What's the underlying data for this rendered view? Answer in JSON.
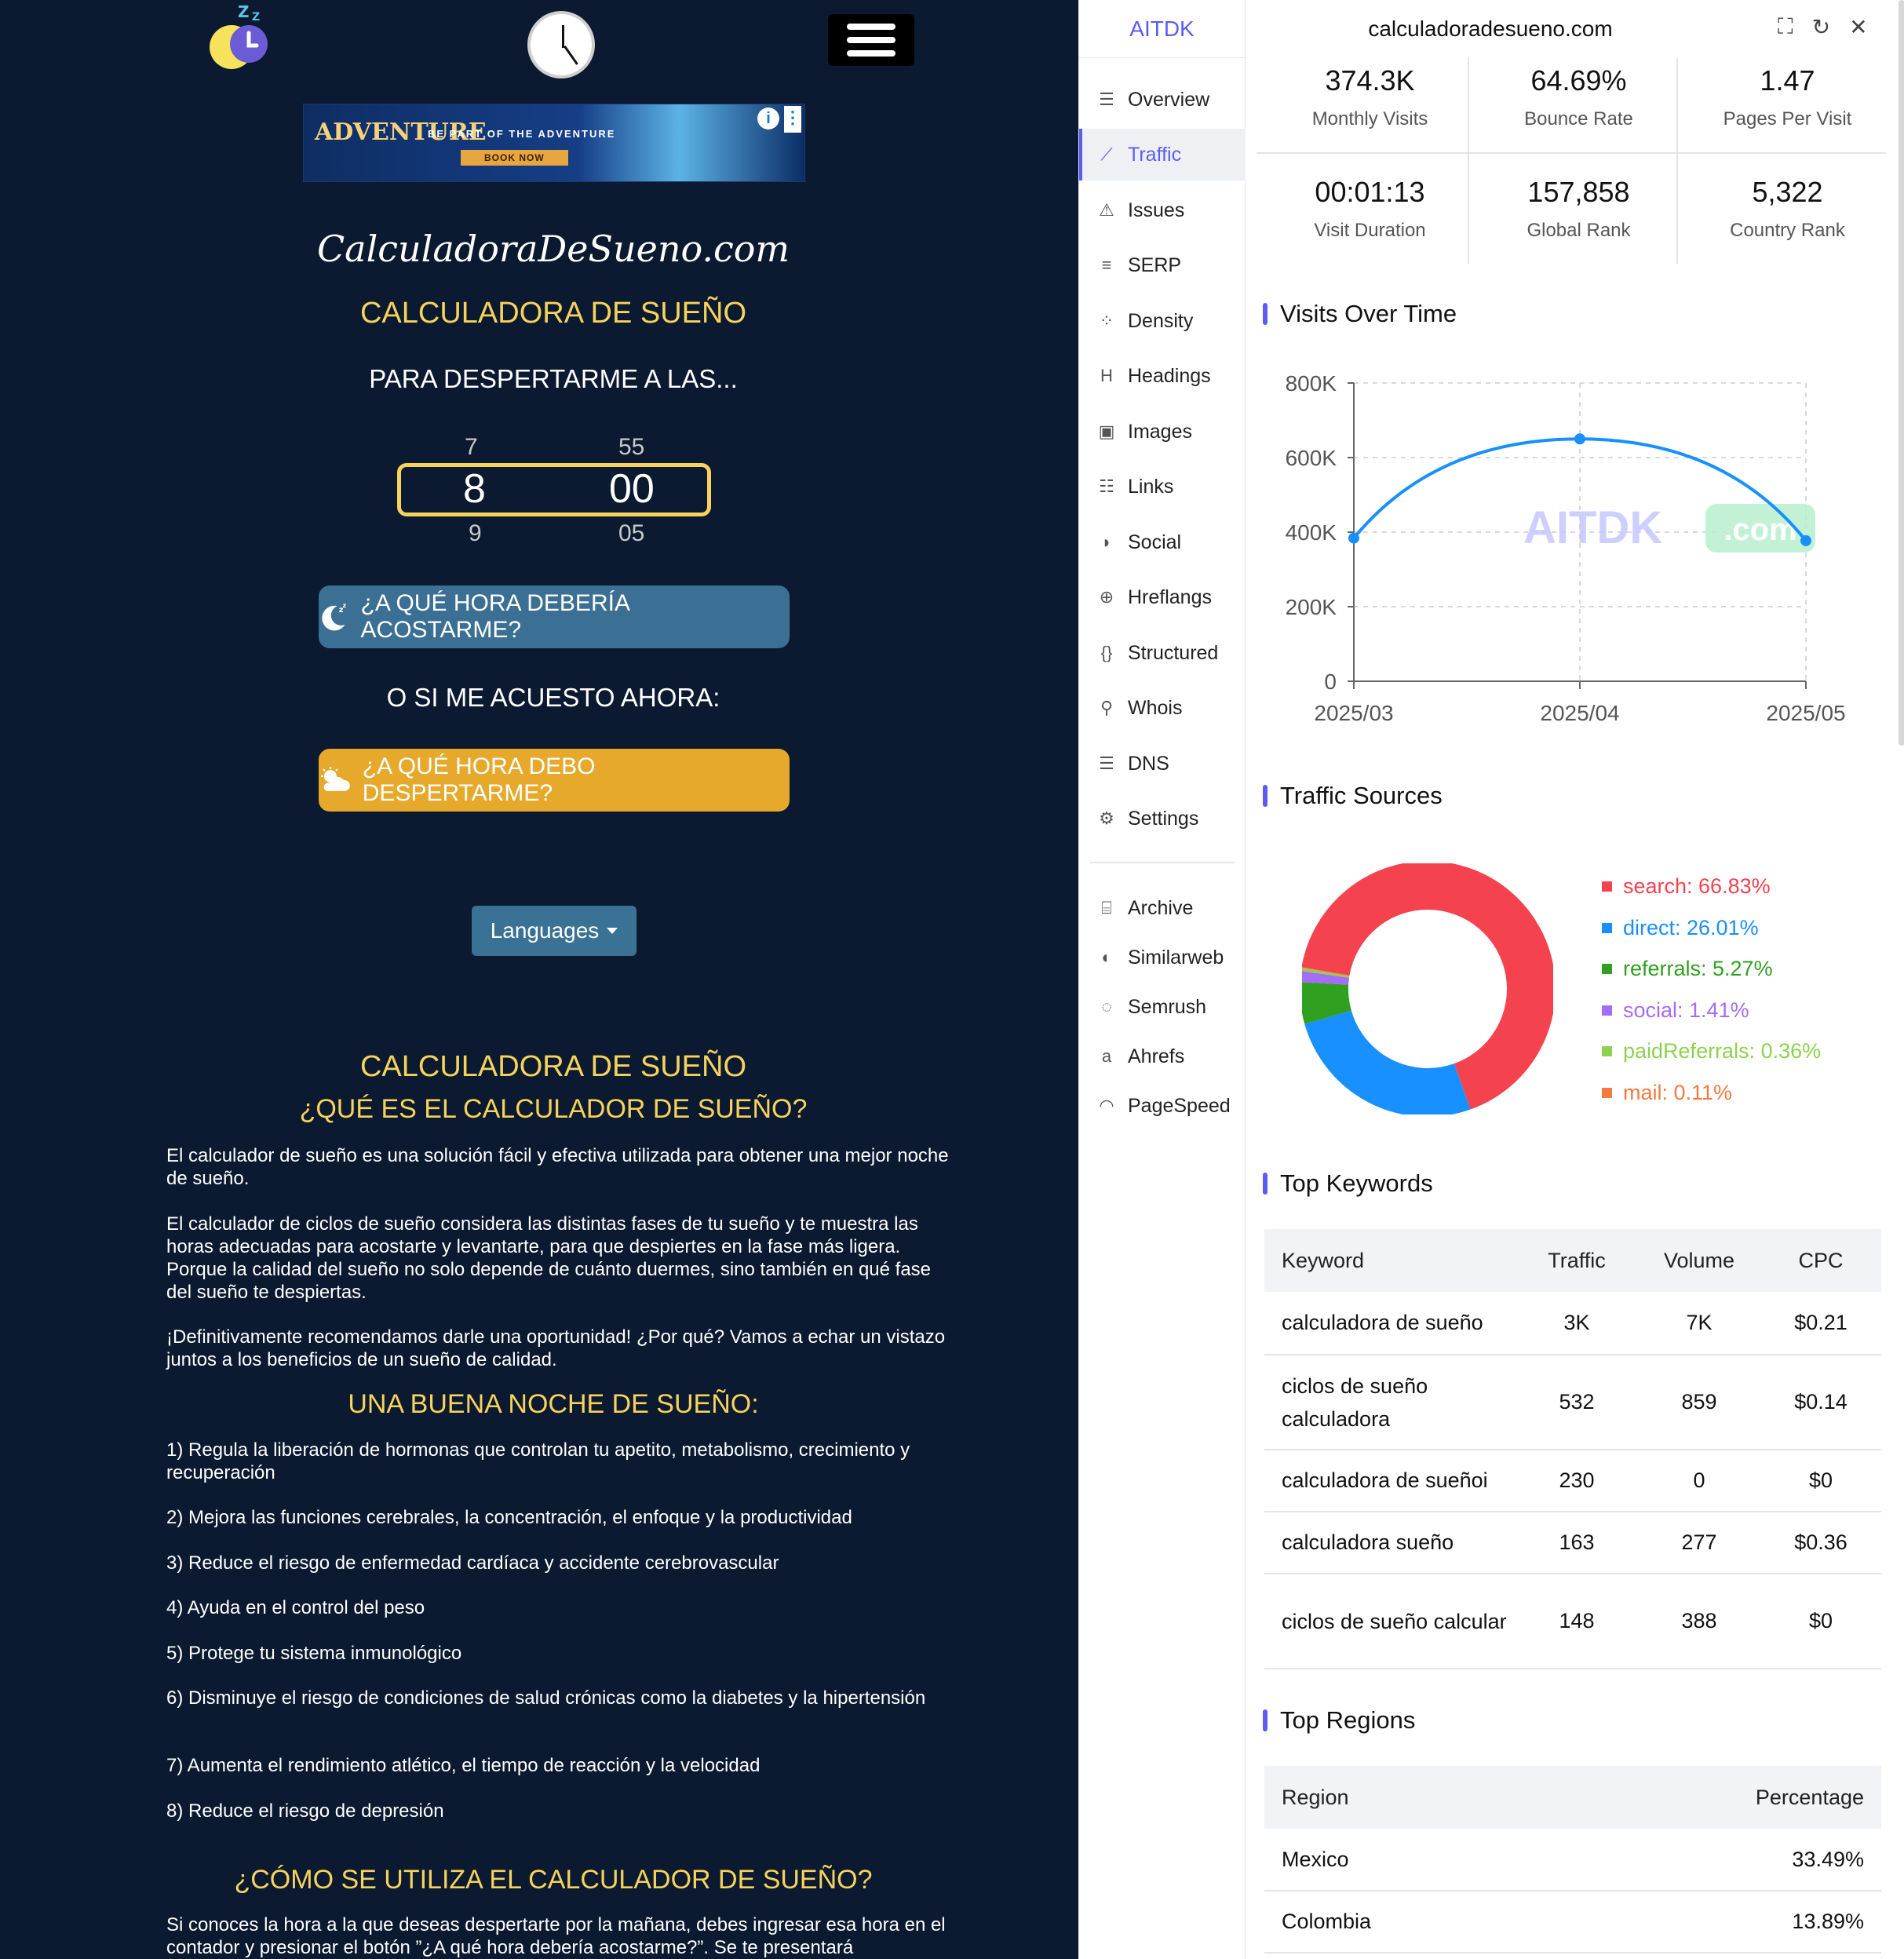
{
  "left": {
    "ad": {
      "brand": "ADVENTURE",
      "tagline": "BE PART OF THE ADVENTURE",
      "cta": "BOOK NOW",
      "info": "i",
      "menu": "⋮"
    },
    "site_logo": "CalculadoraDeSueno.com",
    "heading_main": "CALCULADORA DE SUEÑO",
    "heading_wake_at": "PARA DESPERTARME A LAS...",
    "picker": {
      "hour_prev": "7",
      "hour": "8",
      "hour_next": "9",
      "min_prev": "55",
      "min": "00",
      "min_next": "05"
    },
    "btn_bedtime": "¿A QUÉ HORA DEBERÍA ACOSTARME?",
    "heading_or": "O SI ME ACUESTO AHORA:",
    "btn_wakeup": "¿A QUÉ HORA DEBO DESPERTARME?",
    "btn_languages": "Languages",
    "heading_calc2": "CALCULADORA DE SUEÑO",
    "heading_what": "¿QUÉ ES EL CALCULADOR DE SUEÑO?",
    "p1": "El calculador de sueño es una solución fácil y efectiva utilizada para obtener una mejor noche de sueño.",
    "p2": "El calculador de ciclos de sueño considera las distintas fases de tu sueño y te muestra las horas adecuadas para acostarte y levantarte, para que despiertes en la fase más ligera. Porque la calidad del sueño no solo depende de cuánto duermes, sino también en qué fase del sueño te despiertas.",
    "p3": "¡Definitivamente recomendamos darle una oportunidad! ¿Por qué? Vamos a echar un vistazo juntos a los beneficios de un sueño de calidad.",
    "heading_good": "UNA BUENA NOCHE DE SUEÑO:",
    "benefits": [
      "1) Regula la liberación de hormonas que controlan tu apetito, metabolismo, crecimiento y recuperación",
      "2) Mejora las funciones cerebrales, la concentración, el enfoque y la productividad",
      "3) Reduce el riesgo de enfermedad cardíaca y accidente cerebrovascular",
      "4) Ayuda en el control del peso",
      "5) Protege tu sistema inmunológico",
      "6) Disminuye el riesgo de condiciones de salud crónicas como la diabetes y la hipertensión",
      "7) Aumenta el rendimiento atlético, el tiempo de reacción y la velocidad",
      "8) Reduce el riesgo de depresión"
    ],
    "heading_how": "¿CÓMO SE UTILIZA EL CALCULADOR DE SUEÑO?",
    "p_how": "Si conoces la hora a la que deseas despertarte por la mañana, debes ingresar esa hora en el contador y presionar el botón ”¿A qué hora debería acostarme?”. Se te presentará"
  },
  "right": {
    "brand": "AITDK",
    "domain": "calculadoradesueno.com",
    "nav": [
      "Overview",
      "Traffic",
      "Issues",
      "SERP",
      "Density",
      "Headings",
      "Images",
      "Links",
      "Social",
      "Hreflangs",
      "Structured",
      "Whois",
      "DNS",
      "Settings"
    ],
    "nav_active": "Traffic",
    "nav_tools": [
      "Archive",
      "Similarweb",
      "Semrush",
      "Ahrefs",
      "PageSpeed"
    ],
    "stats": [
      {
        "value": "374.3K",
        "label": "Monthly Visits"
      },
      {
        "value": "64.69%",
        "label": "Bounce Rate"
      },
      {
        "value": "1.47",
        "label": "Pages Per Visit"
      },
      {
        "value": "00:01:13",
        "label": "Visit Duration"
      },
      {
        "value": "157,858",
        "label": "Global Rank"
      },
      {
        "value": "5,322",
        "label": "Country Rank"
      }
    ],
    "visits_title": "Visits Over Time",
    "watermark": "AITDK",
    "watermark_suffix": ".com",
    "sources_title": "Traffic Sources",
    "keywords_title": "Top Keywords",
    "keywords_headers": [
      "Keyword",
      "Traffic",
      "Volume",
      "CPC"
    ],
    "keywords": [
      [
        "calculadora de sueño",
        "3K",
        "7K",
        "$0.21"
      ],
      [
        "ciclos de sueño calculadora",
        "532",
        "859",
        "$0.14"
      ],
      [
        "calculadora de sueñoi",
        "230",
        "0",
        "$0"
      ],
      [
        "calculadora sueño",
        "163",
        "277",
        "$0.36"
      ],
      [
        "ciclos de sueño calcular",
        "148",
        "388",
        "$0"
      ]
    ],
    "regions_title": "Top Regions",
    "regions_headers": [
      "Region",
      "Percentage"
    ],
    "regions": [
      [
        "Mexico",
        "33.49%"
      ],
      [
        "Colombia",
        "13.89%"
      ]
    ],
    "colors": {
      "accent": "#5b5bf5",
      "line": "#1890ff"
    }
  },
  "chart_data": [
    {
      "type": "line",
      "title": "Visits Over Time",
      "x": [
        "2025/03",
        "2025/04",
        "2025/05"
      ],
      "series": [
        {
          "values": [
            384000,
            650000,
            377000
          ]
        }
      ],
      "ylim": [
        0,
        800000
      ],
      "yticks": [
        "0",
        "200K",
        "400K",
        "600K",
        "800K"
      ],
      "grid": true
    },
    {
      "type": "pie",
      "title": "Traffic Sources",
      "labels": [
        "search",
        "direct",
        "referrals",
        "social",
        "paidReferrals",
        "mail"
      ],
      "legend": [
        "search: 66.83%",
        "direct: 26.01%",
        "referrals: 5.27%",
        "social: 1.41%",
        "paidReferrals: 0.36%",
        "mail: 0.11%"
      ],
      "values": [
        66.83,
        26.01,
        5.27,
        1.41,
        0.36,
        0.11
      ],
      "colors": [
        "#f4434f",
        "#1890ff",
        "#2fa01f",
        "#a56cf5",
        "#8fd14f",
        "#f57a3c"
      ],
      "legend_position": "right"
    }
  ]
}
